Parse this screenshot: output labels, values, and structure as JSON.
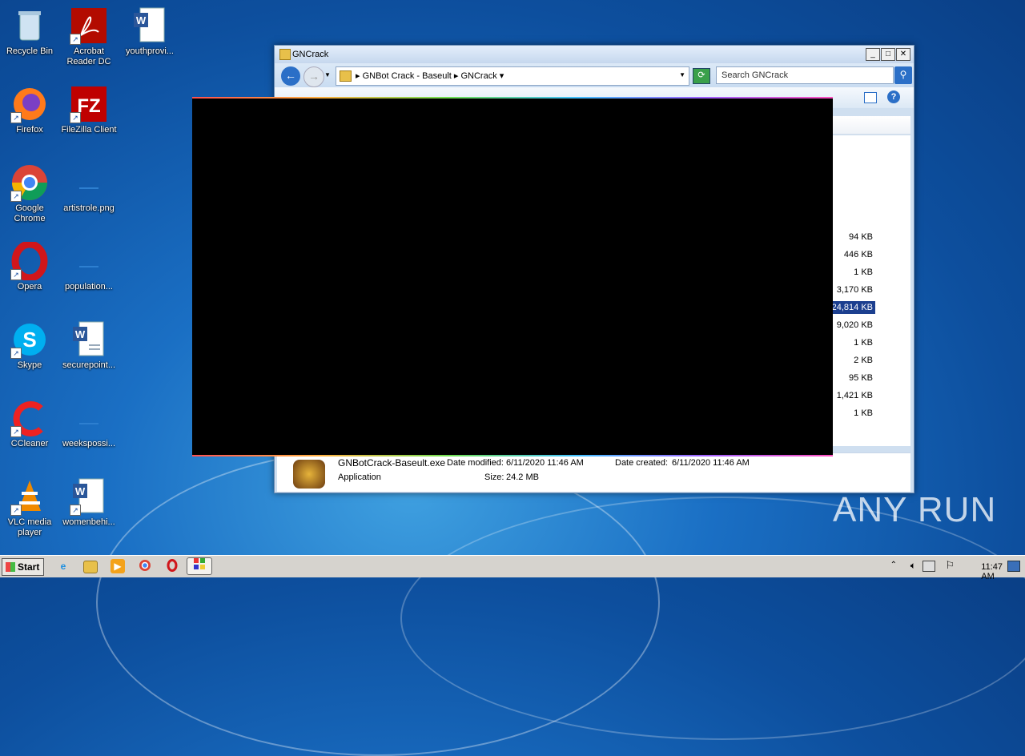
{
  "desktop": {
    "icons": [
      {
        "label": "Recycle Bin"
      },
      {
        "label": "Acrobat Reader DC"
      },
      {
        "label": "youthprovi..."
      },
      {
        "label": "Firefox"
      },
      {
        "label": "FileZilla Client"
      },
      {
        "label": "Google Chrome"
      },
      {
        "label": "artistrole.png"
      },
      {
        "label": "Opera"
      },
      {
        "label": "population..."
      },
      {
        "label": "Skype"
      },
      {
        "label": "securepoint..."
      },
      {
        "label": "CCleaner"
      },
      {
        "label": "weekspossi..."
      },
      {
        "label": "VLC media player"
      },
      {
        "label": "womenbehi..."
      }
    ]
  },
  "explorer": {
    "title": "GNCrack",
    "breadcrumb": [
      "GNBot Crack - Baseult",
      "GNCrack"
    ],
    "search_placeholder": "Search GNCrack",
    "sizes": [
      "94 KB",
      "446 KB",
      "1 KB",
      "3,170 KB",
      "24,814 KB",
      "9,020 KB",
      "1 KB",
      "2 KB",
      "95 KB",
      "1,421 KB",
      "1 KB"
    ],
    "selected_index": 4,
    "details": {
      "filename": "GNBotCrack-Baseult.exe",
      "modified_label": "Date modified:",
      "modified": "6/11/2020 11:46 AM",
      "created_label": "Date created:",
      "created": "6/11/2020 11:46 AM",
      "type": "Application",
      "size_label": "Size:",
      "size": "24.2 MB"
    }
  },
  "taskbar": {
    "start_label": "Start",
    "clock": "11:47 AM"
  },
  "watermark": "ANY RUN"
}
